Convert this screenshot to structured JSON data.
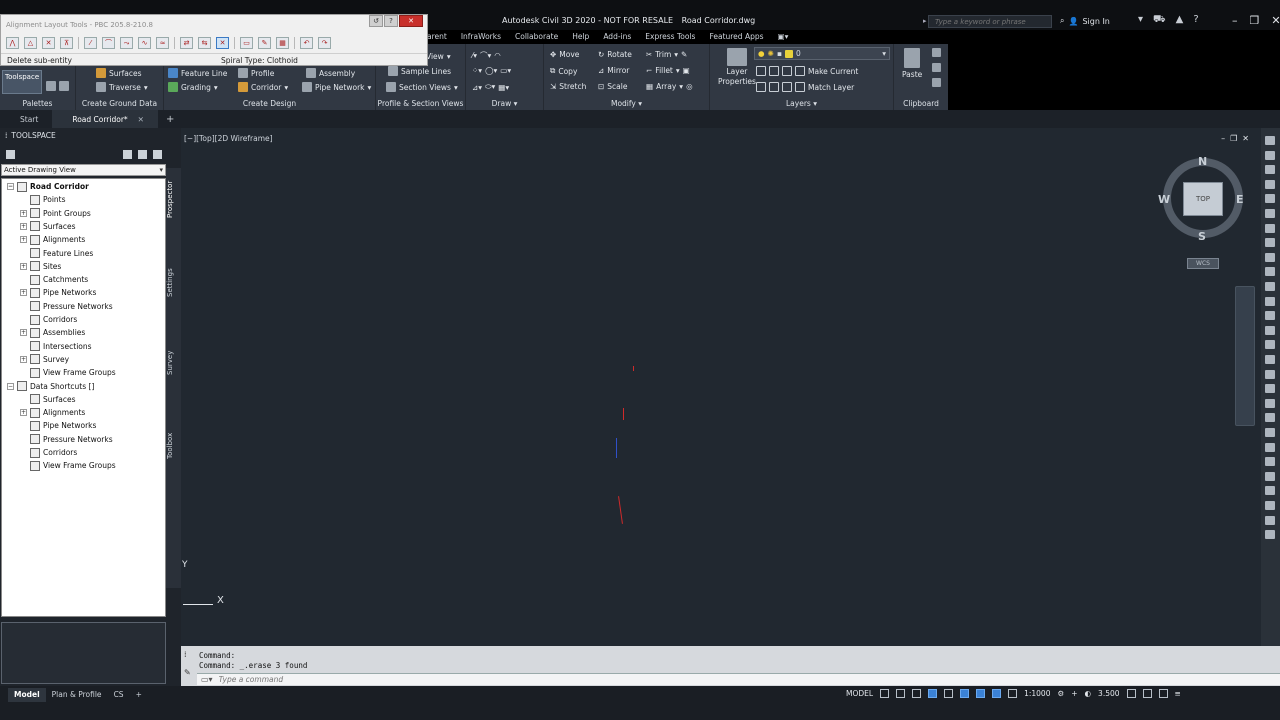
{
  "titlebar": {
    "app_title": "Autodesk Civil 3D 2020 - NOT FOR RESALE",
    "file_name": "Road Corridor.dwg",
    "search_placeholder": "Type a keyword or phrase",
    "signin_label": "Sign In"
  },
  "menubar": {
    "items": [
      "arent",
      "InfraWorks",
      "Collaborate",
      "Help",
      "Add-ins",
      "Express Tools",
      "Featured Apps"
    ]
  },
  "alignment_tools": {
    "title": "Alignment Layout Tools - PBC 205.8-210.8",
    "delete_label": "Delete sub-entity",
    "spiral_label": "Spiral Type: Clothoid"
  },
  "ribbon": {
    "toolspace_label": "Toolspace",
    "groups": {
      "palettes": "Palettes",
      "create_ground": "Create Ground Data",
      "create_design": "Create Design",
      "profile_section": "Profile & Section Views",
      "draw": "Draw",
      "modify": "Modify",
      "layers": "Layers",
      "clipboard": "Clipboard"
    },
    "buttons": {
      "surfaces": "Surfaces",
      "feature_line": "Feature Line",
      "profile": "Profile",
      "assembly": "Assembly",
      "traverse": "Traverse",
      "grading": "Grading",
      "corridor": "Corridor",
      "pipe_network": "Pipe Network",
      "view": "View",
      "sample_lines": "Sample Lines",
      "section_views": "Section Views",
      "move": "Move",
      "rotate": "Rotate",
      "trim": "Trim",
      "copy": "Copy",
      "mirror": "Mirror",
      "fillet": "Fillet",
      "stretch": "Stretch",
      "scale": "Scale",
      "array": "Array",
      "layer_properties_1": "Layer",
      "layer_properties_2": "Properties",
      "make_current": "Make Current",
      "match_layer": "Match Layer",
      "paste": "Paste",
      "layer_value": "0"
    }
  },
  "doc_tabs": {
    "start": "Start",
    "active": "Road Corridor*"
  },
  "toolspace": {
    "title": "TOOLSPACE",
    "view_mode": "Active Drawing View",
    "vtabs": [
      "Prospector",
      "Settings",
      "Survey",
      "Toolbox"
    ],
    "tree": [
      {
        "label": "Road Corridor",
        "level": 0,
        "expander": "−",
        "bold": true
      },
      {
        "label": "Points",
        "level": 1,
        "expander": ""
      },
      {
        "label": "Point Groups",
        "level": 1,
        "expander": "+"
      },
      {
        "label": "Surfaces",
        "level": 1,
        "expander": "+"
      },
      {
        "label": "Alignments",
        "level": 1,
        "expander": "+"
      },
      {
        "label": "Feature Lines",
        "level": 1,
        "expander": ""
      },
      {
        "label": "Sites",
        "level": 1,
        "expander": "+"
      },
      {
        "label": "Catchments",
        "level": 1,
        "expander": ""
      },
      {
        "label": "Pipe Networks",
        "level": 1,
        "expander": "+"
      },
      {
        "label": "Pressure Networks",
        "level": 1,
        "expander": ""
      },
      {
        "label": "Corridors",
        "level": 1,
        "expander": ""
      },
      {
        "label": "Assemblies",
        "level": 1,
        "expander": "+"
      },
      {
        "label": "Intersections",
        "level": 1,
        "expander": ""
      },
      {
        "label": "Survey",
        "level": 1,
        "expander": "+"
      },
      {
        "label": "View Frame Groups",
        "level": 1,
        "expander": ""
      },
      {
        "label": "Data Shortcuts []",
        "level": 0,
        "expander": "−"
      },
      {
        "label": "Surfaces",
        "level": 1,
        "expander": ""
      },
      {
        "label": "Alignments",
        "level": 1,
        "expander": "+"
      },
      {
        "label": "Pipe Networks",
        "level": 1,
        "expander": ""
      },
      {
        "label": "Pressure Networks",
        "level": 1,
        "expander": ""
      },
      {
        "label": "Corridors",
        "level": 1,
        "expander": ""
      },
      {
        "label": "View Frame Groups",
        "level": 1,
        "expander": ""
      }
    ]
  },
  "viewport": {
    "label": "[−][Top][2D Wireframe]",
    "viewcube": {
      "top": "TOP",
      "n": "N",
      "s": "S",
      "e": "E",
      "w": "W",
      "wcs": "WCS"
    },
    "ucs": {
      "x": "X",
      "y": "Y"
    }
  },
  "command": {
    "history": [
      "Command:",
      "Command:  _.erase 3 found"
    ],
    "placeholder": "Type a command"
  },
  "statusbar": {
    "layouts": [
      "Model",
      "Plan & Profile",
      "CS"
    ],
    "model_label": "MODEL",
    "scale": "1:1000",
    "value": "3.500"
  },
  "colors": {
    "canvas": "#212830",
    "ribbon": "#313843",
    "accent": "#3b82d6",
    "mark_red": "#d02a2a"
  }
}
